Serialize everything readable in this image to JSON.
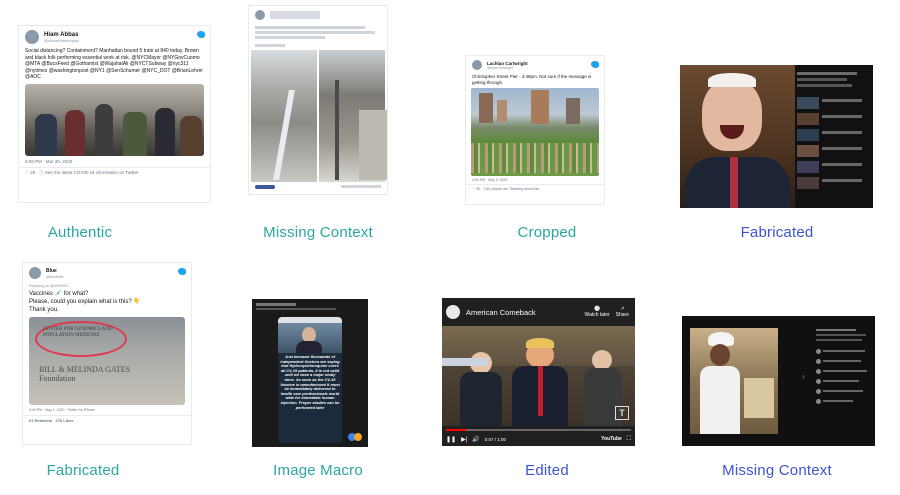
{
  "captions": {
    "c1": "Authentic",
    "c2": "Missing Context",
    "c3": "Cropped",
    "c4": "Fabricated",
    "c5": "Fabricated",
    "c6": "Image Macro",
    "c7": "Edited",
    "c8": "Missing Context"
  },
  "colors": {
    "teal": "#2aa7a0",
    "blue": "#3b55d0"
  },
  "t1": {
    "name": "Hiam Abbas",
    "handle": "@showmethesquity",
    "text": "Social distancing? Containment? Manhattan bound 5 train at 840 today. Brown and black folk performing essential work at risk. @NYCMayor @NYGovCuomo @MTA @BucsFeed @Gothamist @WajahatAli @NYCTSubway @nyc311 @nytimes @washingtonpost @NY1 @SenSchumer @NYC_DOT @BrianLehrer @AOC",
    "time": "5:09 PM · Mar 30, 2020",
    "likes": "29",
    "info": "See the latest COVID-19 information on Twitter"
  },
  "t3": {
    "name": "Lachlan Cartwright",
    "handle": "@lachCartwright",
    "text": "Christopher Street Pier - 4:48pm. Not sure if the message is getting through.",
    "time": "4:09 PM · May 3, 2020",
    "likes": "3K",
    "info": "7.6K people are Tweeting about this"
  },
  "t5": {
    "name": "Blue",
    "handle": "@BlueMe",
    "reply": "Replying to @MSNBC",
    "text": "Vaccines 💉 for what?\nPlease, could you explain what is this? 👇\nThank you.",
    "sign1": "CENTER FOR GENOMICS AND POPULATION MEDICINE",
    "sign2": "BILL & MELINDA GATES Foundation",
    "time": "3:40 PM · May 1, 2020 · Twitter for iPhone",
    "rt": "61 Retweets",
    "likes": "276 Likes"
  },
  "macro": "Just because thousands of independent Doctors are saying that Hydroxychloroquine cures all CV-19 patients, it is not valid until we have a major study done. As soon as the CV-19 Vaccine is manufactured it must be immediately delivered to health care professionals world wide for immediate human injection. Proper studies can be performed later",
  "video": {
    "title": "American Comeback",
    "watch": "Watch later",
    "share": "Share",
    "time": "0:07 / 1:00"
  }
}
